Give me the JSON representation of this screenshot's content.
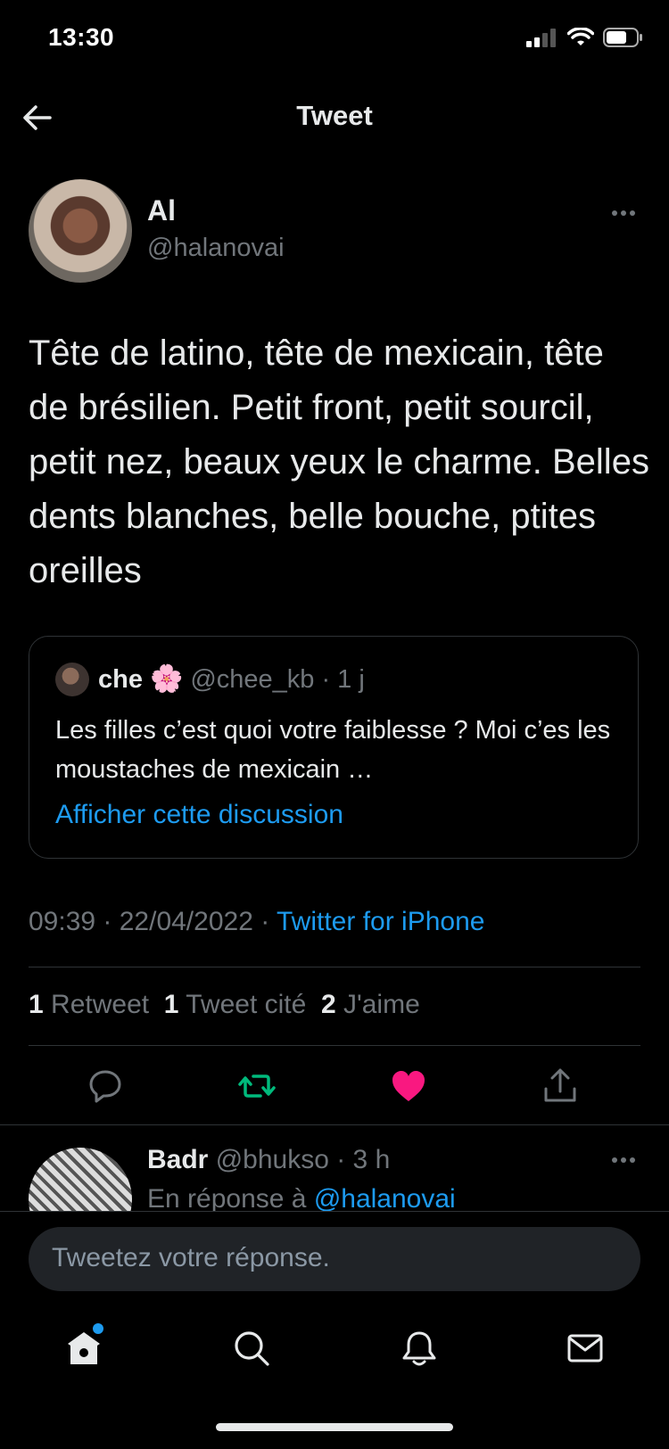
{
  "status_bar": {
    "time": "13:30"
  },
  "header": {
    "title": "Tweet"
  },
  "tweet": {
    "author_name": "Al",
    "author_handle": "@halanovai",
    "text": "Tête de latino, tête de mexicain, tête de brésilien. Petit front, petit sourcil, petit nez, beaux yeux le charme. Belles dents blanches, belle bouche, ptites oreilles",
    "quote": {
      "name": "che",
      "emoji": "🌸",
      "handle": "@chee_kb",
      "time": "· 1 j",
      "text": "Les filles c’est quoi votre faiblesse ? Moi c’es les moustaches de mexicain …",
      "link": "Afficher cette discussion"
    },
    "timestamp": "09:39 · 22/04/2022 ·",
    "source": "Twitter for iPhone",
    "stats": {
      "retweets_count": "1",
      "retweets_label": "Retweet",
      "quotes_count": "1",
      "quotes_label": "Tweet cité",
      "likes_count": "2",
      "likes_label": "J'aime"
    }
  },
  "reply": {
    "name": "Badr",
    "handle_time": "@bhukso · 3 h",
    "in_reply_prefix": "En réponse à",
    "in_reply_mention": "@halanovai"
  },
  "composer": {
    "placeholder": "Tweetez votre réponse."
  },
  "colors": {
    "accent": "#1d9bf0",
    "like": "#f91880",
    "retweet": "#00ba7c",
    "background": "#000000"
  }
}
